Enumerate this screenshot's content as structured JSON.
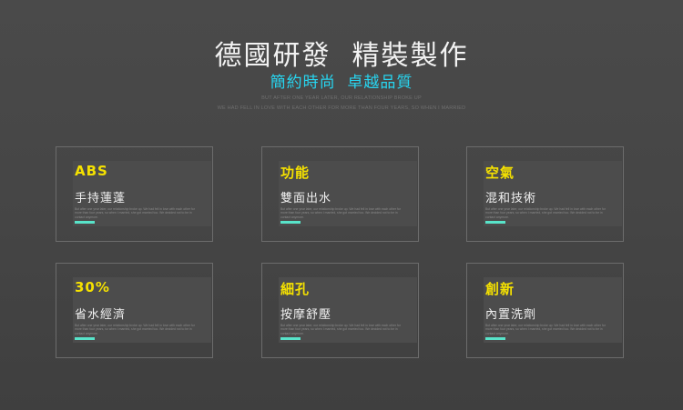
{
  "header": {
    "title": "德國研發  精裝製作",
    "subtitle": "簡約時尚  卓越品質",
    "tagline_line1": "BUT AFTER ONE YEAR LATER, OUR RELATIONSHIP BROKE UP",
    "tagline_line2": "WE HAD FELL IN LOVE WITH EACH OTHER FOR MORE THAN FOUR YEARS, SO WHEN I MARRIED"
  },
  "accent_colors": {
    "subtitle": "#27d5f0",
    "heading": "#f5e100",
    "bar": "#58e3c9"
  },
  "features": [
    {
      "heading": "ABS",
      "label": "手持蓮蓬",
      "desc": "But after one year later, our relationship broke up. We had fell in love with each other for more than four years, so when I married, she got married too. We decided not to be in contact anymore."
    },
    {
      "heading": "功能",
      "label": "雙面出水",
      "desc": "But after one year later, our relationship broke up. We had fell in love with each other for more than four years, so when I married, she got married too. We decided not to be in contact anymore."
    },
    {
      "heading": "空氣",
      "label": "混和技術",
      "desc": "But after one year later, our relationship broke up. We had fell in love with each other for more than four years, so when I married, she got married too. We decided not to be in contact anymore."
    },
    {
      "heading": "30%",
      "label": "省水經濟",
      "desc": "But after one year later, our relationship broke up. We had fell in love with each other for more than four years, so when I married, she got married too. We decided not to be in contact anymore."
    },
    {
      "heading": "細孔",
      "label": "按摩舒壓",
      "desc": "But after one year later, our relationship broke up. We had fell in love with each other for more than four years, so when I married, she got married too. We decided not to be in contact anymore."
    },
    {
      "heading": "創新",
      "label": "內置洗劑",
      "desc": "But after one year later, our relationship broke up. We had fell in love with each other for more than four years, so when I married, she got married too. We decided not to be in contact anymore."
    }
  ]
}
